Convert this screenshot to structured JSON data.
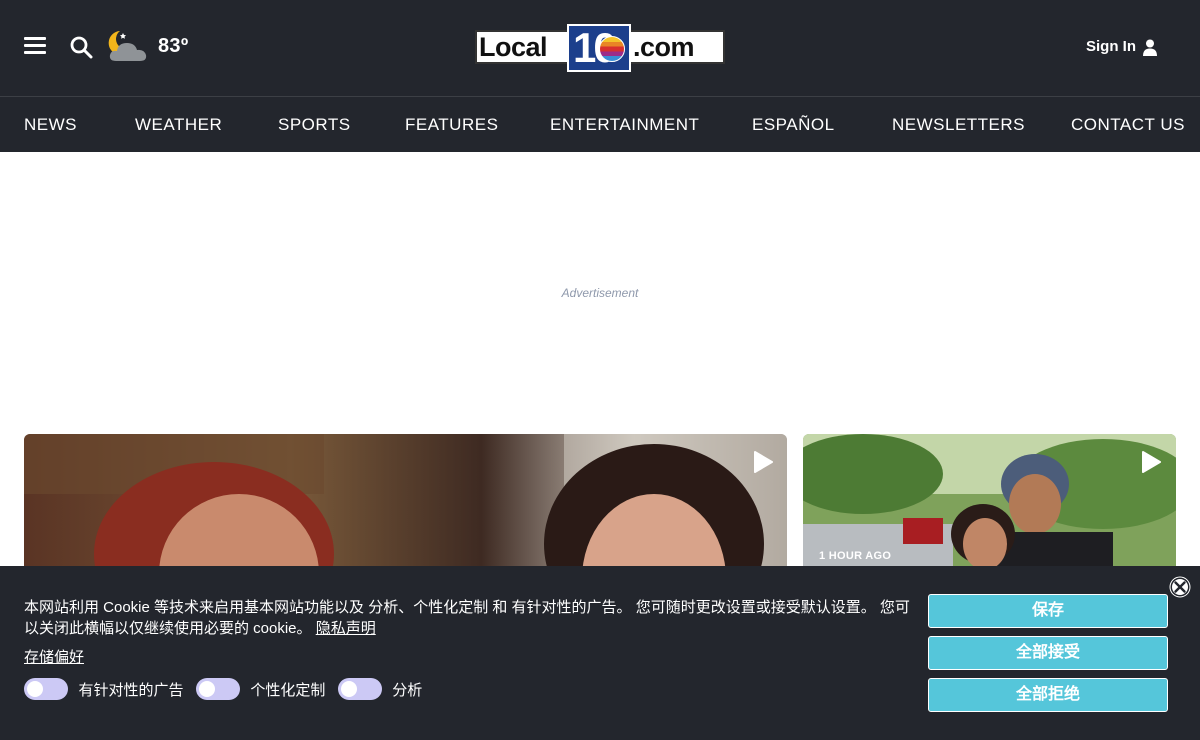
{
  "header": {
    "temperature": "83º",
    "logo": {
      "part1": "Local",
      "part2": "10",
      "part3": ".com"
    },
    "sign_in": "Sign In",
    "icons": {
      "menu": "hamburger-menu-icon",
      "search": "search-icon",
      "weather": "partly-cloudy-night-icon",
      "user": "user-icon"
    }
  },
  "nav": {
    "items": [
      "NEWS",
      "WEATHER",
      "SPORTS",
      "FEATURES",
      "ENTERTAINMENT",
      "ESPAÑOL",
      "NEWSLETTERS",
      "CONTACT US"
    ]
  },
  "ad": {
    "label": "Advertisement"
  },
  "cards": [
    {
      "timestamp": "",
      "icon": "play-icon"
    },
    {
      "timestamp": "1 HOUR AGO",
      "icon": "play-icon"
    }
  ],
  "cookie_banner": {
    "text": "本网站利用 Cookie 等技术来启用基本网站功能以及 分析、个性化定制 和 有针对性的广告。 您可随时更改设置或接受默认设置。 您可以关闭此横幅以仅继续使用必要的 cookie。",
    "privacy_link": "隐私声明",
    "preferences_link": "存储偏好",
    "toggles": [
      {
        "label": "有针对性的广告"
      },
      {
        "label": "个性化定制"
      },
      {
        "label": "分析"
      }
    ],
    "buttons": {
      "save": "保存",
      "accept_all": "全部接受",
      "reject_all": "全部拒绝"
    },
    "close_icon": "close-icon"
  },
  "colors": {
    "header_bg": "#23262d",
    "button_bg": "#55c6da",
    "toggle_bg": "#ccc9f5",
    "logo_blue": "#1c3f8c"
  }
}
